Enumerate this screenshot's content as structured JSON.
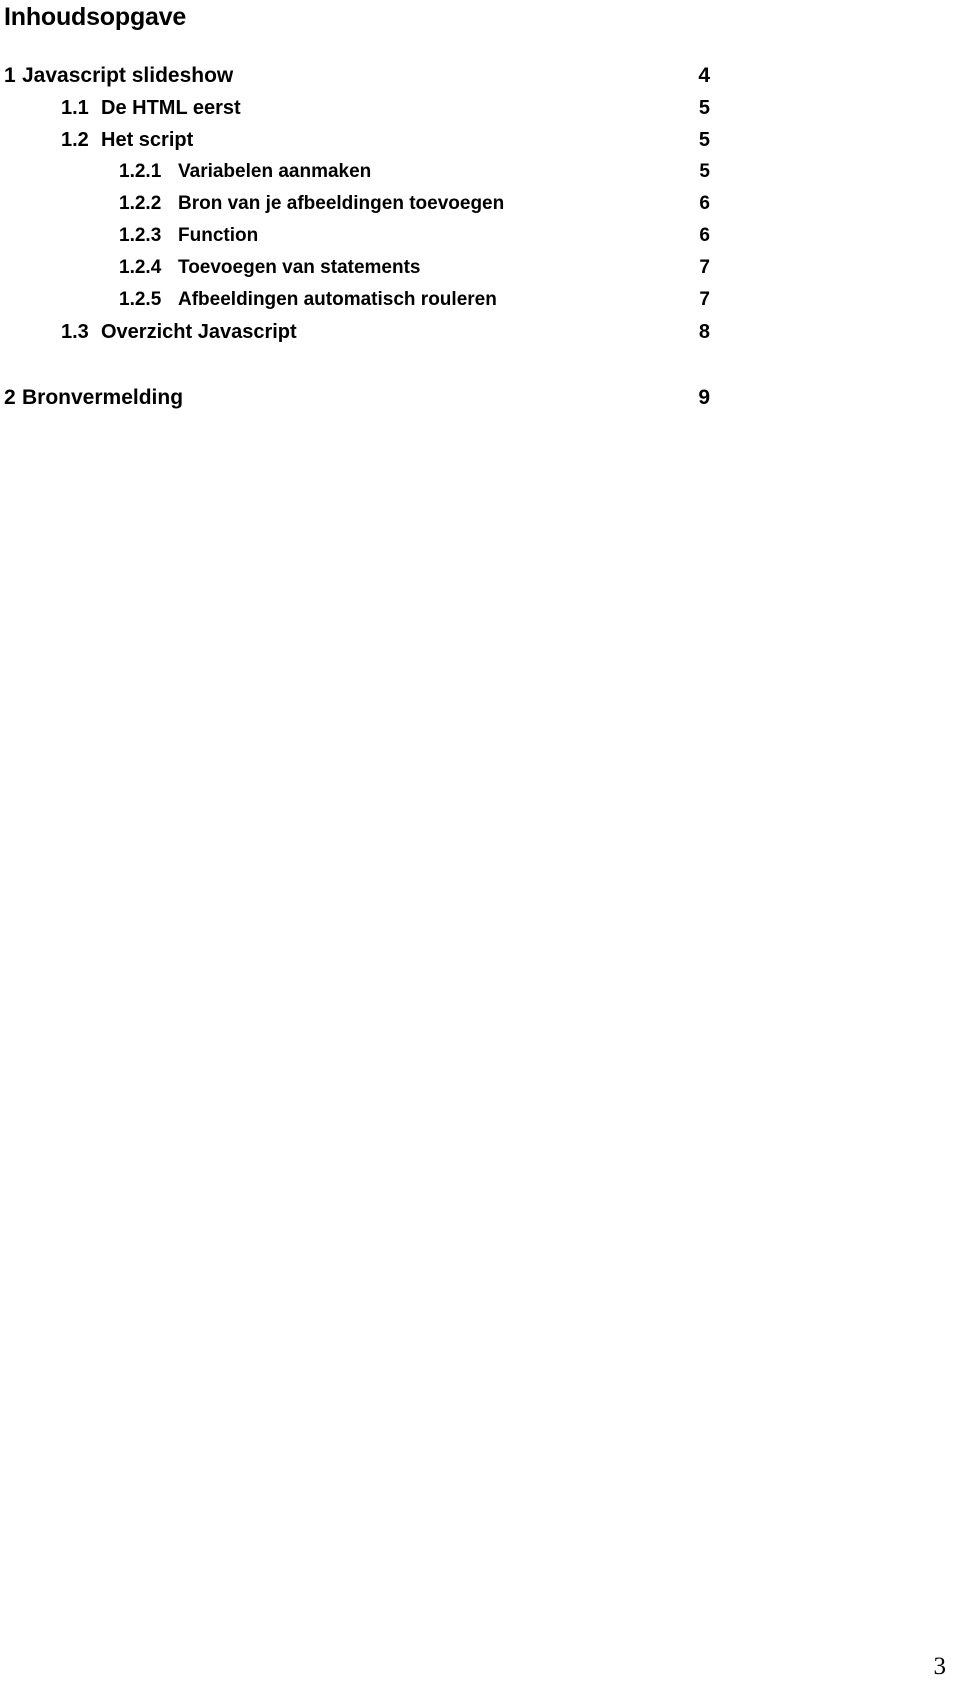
{
  "document": {
    "heading": "Inhoudsopgave",
    "footer_page_number": "3"
  },
  "toc": {
    "entries": [
      {
        "number": "1",
        "label": "Javascript slideshow",
        "page": "4",
        "level": 1
      },
      {
        "number": "1.1",
        "label": "De HTML eerst",
        "page": "5",
        "level": 2
      },
      {
        "number": "1.2",
        "label": "Het script",
        "page": "5",
        "level": 2
      },
      {
        "number": "1.2.1",
        "label": "Variabelen aanmaken",
        "page": "5",
        "level": 3
      },
      {
        "number": "1.2.2",
        "label": "Bron van je afbeeldingen toevoegen",
        "page": "6",
        "level": 3
      },
      {
        "number": "1.2.3",
        "label": "Function",
        "page": "6",
        "level": 3
      },
      {
        "number": "1.2.4",
        "label": "Toevoegen van statements",
        "page": "7",
        "level": 3
      },
      {
        "number": "1.2.5",
        "label": "Afbeeldingen automatisch rouleren",
        "page": "7",
        "level": 3
      },
      {
        "number": "1.3",
        "label": "Overzicht Javascript",
        "page": "8",
        "level": 2
      },
      {
        "number": "2",
        "label": "Bronvermelding",
        "page": "9",
        "level": 1,
        "gap_before": true
      }
    ]
  }
}
